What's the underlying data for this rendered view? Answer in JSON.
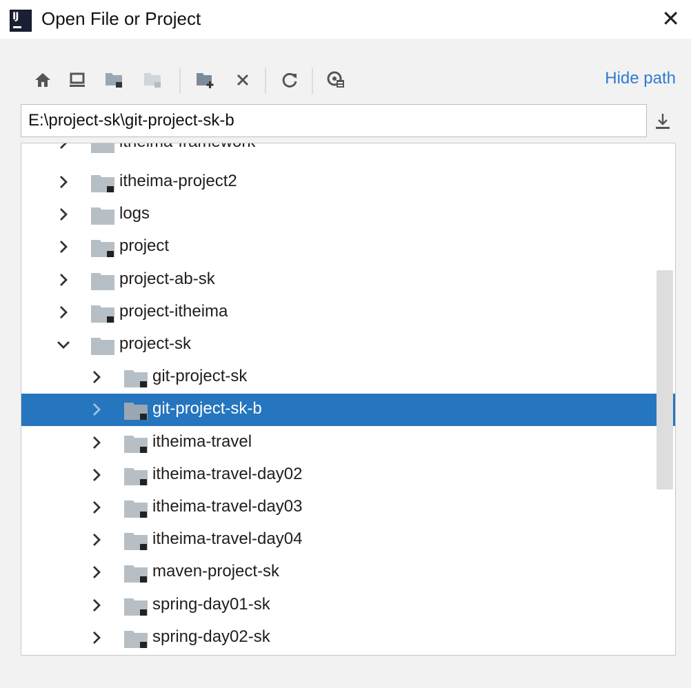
{
  "window": {
    "title": "Open File or Project",
    "close_label": "✕"
  },
  "toolbar": {
    "buttons": [
      {
        "icon": "home-icon"
      },
      {
        "icon": "desktop-icon"
      },
      {
        "icon": "project-folder-icon"
      },
      {
        "icon": "module-folder-icon"
      },
      {
        "icon": "new-folder-icon"
      },
      {
        "icon": "delete-icon"
      },
      {
        "icon": "refresh-icon"
      },
      {
        "icon": "show-hidden-icon"
      }
    ],
    "hide_path_label": "Hide path"
  },
  "path": {
    "value": "E:\\project-sk\\git-project-sk-b"
  },
  "tree": {
    "partial_top_label": "itheima-framework",
    "items": [
      {
        "label": "itheima-project2",
        "level": 0,
        "expanded": false,
        "project": true,
        "selected": false
      },
      {
        "label": "logs",
        "level": 0,
        "expanded": false,
        "project": false,
        "selected": false
      },
      {
        "label": "project",
        "level": 0,
        "expanded": false,
        "project": true,
        "selected": false
      },
      {
        "label": "project-ab-sk",
        "level": 0,
        "expanded": false,
        "project": false,
        "selected": false
      },
      {
        "label": "project-itheima",
        "level": 0,
        "expanded": false,
        "project": true,
        "selected": false
      },
      {
        "label": "project-sk",
        "level": 0,
        "expanded": true,
        "project": false,
        "selected": false
      },
      {
        "label": "git-project-sk",
        "level": 1,
        "expanded": false,
        "project": true,
        "selected": false
      },
      {
        "label": "git-project-sk-b",
        "level": 1,
        "expanded": false,
        "project": true,
        "selected": true
      },
      {
        "label": "itheima-travel",
        "level": 1,
        "expanded": false,
        "project": true,
        "selected": false
      },
      {
        "label": "itheima-travel-day02",
        "level": 1,
        "expanded": false,
        "project": true,
        "selected": false
      },
      {
        "label": "itheima-travel-day03",
        "level": 1,
        "expanded": false,
        "project": true,
        "selected": false
      },
      {
        "label": "itheima-travel-day04",
        "level": 1,
        "expanded": false,
        "project": true,
        "selected": false
      },
      {
        "label": "maven-project-sk",
        "level": 1,
        "expanded": false,
        "project": true,
        "selected": false
      },
      {
        "label": "spring-day01-sk",
        "level": 1,
        "expanded": false,
        "project": true,
        "selected": false
      },
      {
        "label": "spring-day02-sk",
        "level": 1,
        "expanded": false,
        "project": true,
        "selected": false
      }
    ]
  },
  "colors": {
    "accent": "#2675bf",
    "link": "#2f7bd0",
    "folder": "#b7bfc6",
    "background": "#f2f2f2"
  }
}
